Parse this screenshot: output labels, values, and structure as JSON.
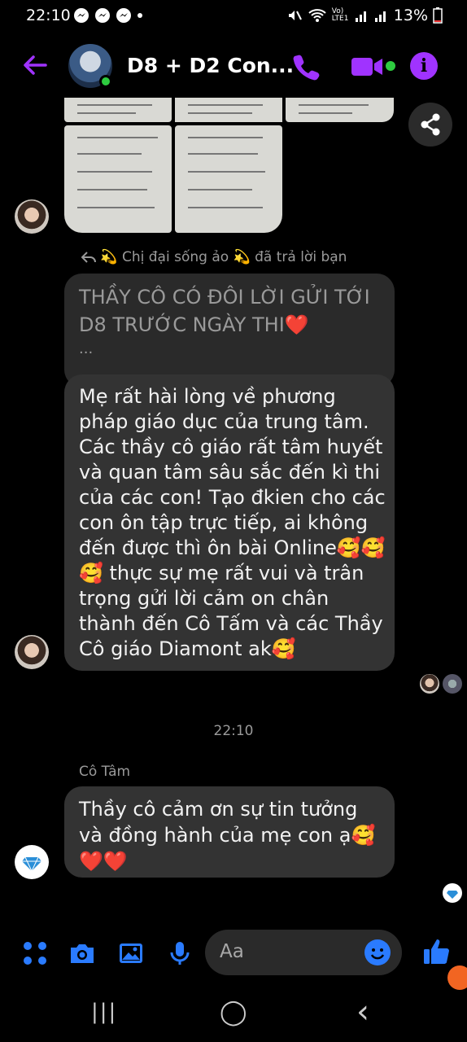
{
  "status_bar": {
    "time": "22:10",
    "battery": "13%",
    "network": "Vo) LTE1"
  },
  "header": {
    "title": "D8 + D2 Con...",
    "back_icon": "back-arrow-icon",
    "call_icon": "phone-icon",
    "video_icon": "video-camera-icon",
    "info_icon": "info-icon",
    "info_glyph": "i"
  },
  "colors": {
    "accent": "#a033ff",
    "composer_blue": "#2a7bff",
    "bubble": "#333333",
    "online": "#2ecc40"
  },
  "reply": {
    "note": "Chị đại sống ảo 💫 đã trả lời bạn",
    "note_prefix": "💫",
    "quoted_lines": [
      "THẦY CÔ CÓ ĐÔI LỜI GỬI TỚI",
      "D8 TRƯỚC NGÀY THI",
      "..."
    ],
    "quoted_heart": "❤️"
  },
  "message_parent": {
    "lines": [
      "Mẹ rất hài lòng về phương",
      "pháp giáo dục của trung tâm.",
      "Các thầy cô giáo rất tâm huyết",
      "và quan tâm sâu sắc đến kì thi",
      "của các con! Tạo đkien cho các",
      "con ôn tập trực tiếp, ai không",
      "đến được thì ôn bài Online🥰🥰",
      "🥰 thực sự mẹ rất vui và trân",
      "trọng gửi lời cảm on chân",
      "thành đến Cô Tấm và các Thầy",
      "Cô giáo Diamont ak🥰"
    ]
  },
  "timestamp": "22:10",
  "teacher": {
    "sender": "Cô Tâm",
    "lines": [
      "Thầy cô cảm ơn sự tin tưởng",
      "và đồng hành của mẹ con ạ🥰",
      "❤️❤️"
    ]
  },
  "composer": {
    "placeholder": "Aa",
    "icons": [
      "grid-menu-icon",
      "camera-icon",
      "image-icon",
      "microphone-icon",
      "emoji-icon",
      "thumbs-up-icon"
    ]
  },
  "navbar": {
    "recents_glyph": "|||",
    "home_glyph": "◯",
    "back_glyph": "‹"
  }
}
